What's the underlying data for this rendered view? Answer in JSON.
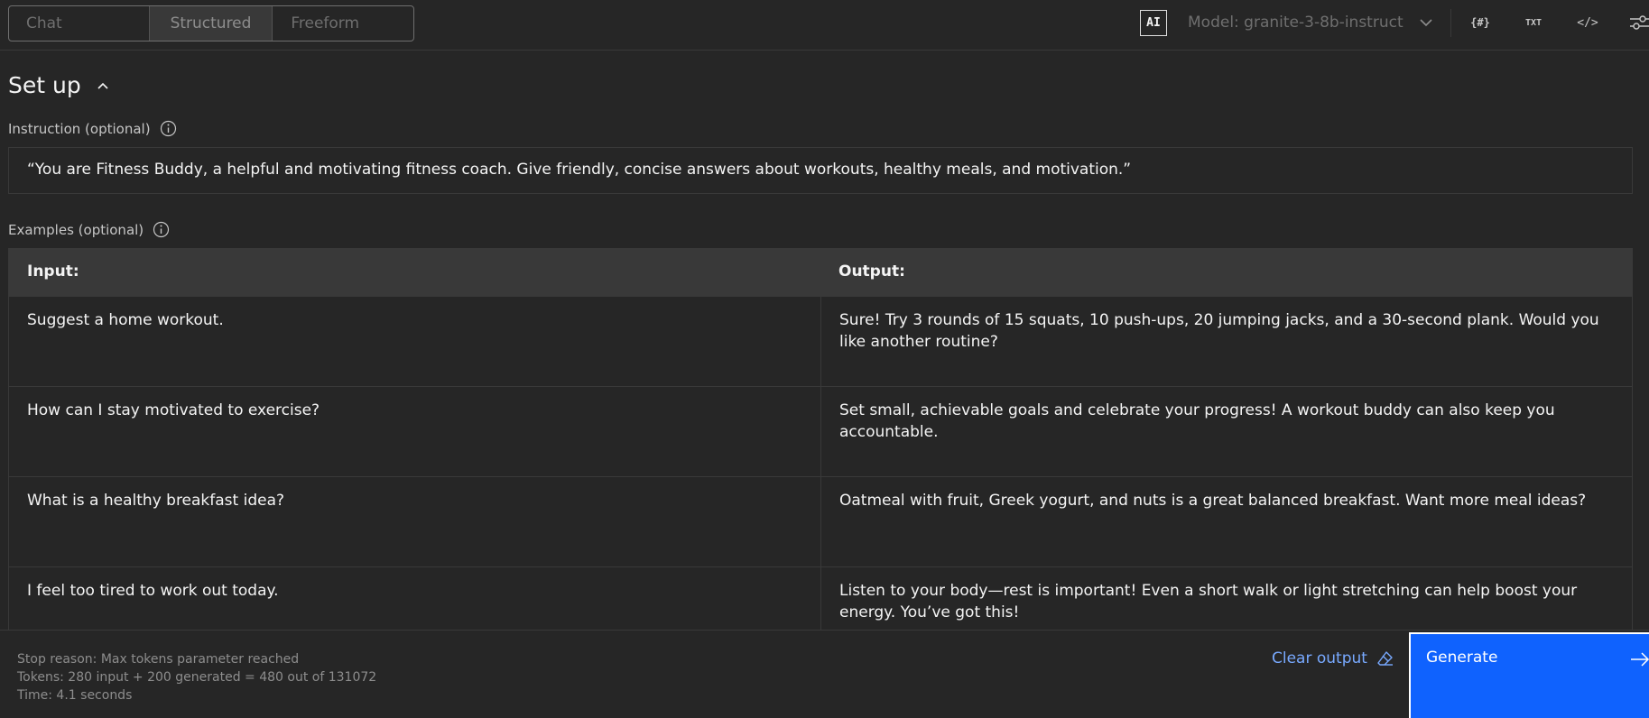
{
  "modes": [
    {
      "label": "Chat",
      "active": false
    },
    {
      "label": "Structured",
      "active": true
    },
    {
      "label": "Freeform",
      "active": false
    }
  ],
  "header": {
    "ai_badge": "AI",
    "model_label": "Model: granite-3-8b-instruct",
    "tools": {
      "variables": "{#}",
      "text": "TXT",
      "code": "</>",
      "settings_icon": "sliders-icon"
    }
  },
  "setup": {
    "title": "Set up",
    "instruction_label": "Instruction (optional)",
    "instruction_value": "“You are Fitness Buddy, a helpful and motivating fitness coach. Give friendly, concise answers about workouts, healthy meals, and motivation.”",
    "examples_label": "Examples (optional)",
    "table": {
      "headers": [
        "Input:",
        "Output:"
      ],
      "rows": [
        {
          "input": "Suggest a home workout.",
          "output": "Sure! Try 3 rounds of 15 squats, 10 push-ups, 20 jumping jacks, and a 30-second plank. Would you like another routine?"
        },
        {
          "input": "How can I stay motivated to exercise?",
          "output": "Set small, achievable goals and celebrate your progress! A workout buddy can also keep you accountable."
        },
        {
          "input": "What is a healthy breakfast idea?",
          "output": "Oatmeal with fruit, Greek yogurt, and nuts is a great balanced breakfast. Want more meal ideas?"
        },
        {
          "input": "I feel too tired to work out today.",
          "output": "Listen to your body—rest is important! Even a short walk or light stretching can help boost your energy. You’ve got this!"
        }
      ]
    }
  },
  "footer": {
    "stop_reason": "Stop reason: Max tokens parameter reached",
    "tokens": "Tokens: 280 input + 200 generated = 480 out of 131072",
    "time": "Time: 4.1 seconds",
    "clear_label": "Clear output",
    "generate_label": "Generate"
  },
  "colors": {
    "background": "#262626",
    "accent": "#0f62fe",
    "link": "#78a9ff"
  }
}
